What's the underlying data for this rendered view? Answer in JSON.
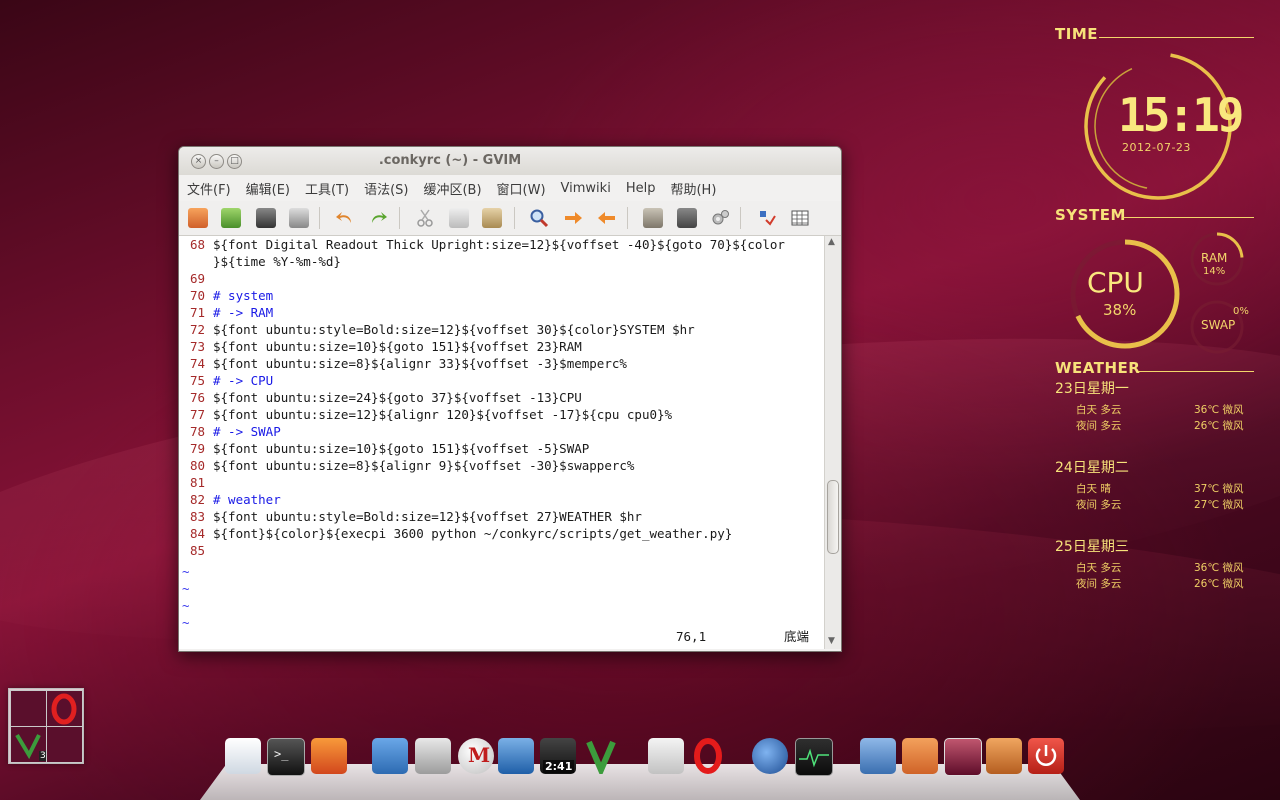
{
  "gvim": {
    "title": ".conkyrc (~) - GVIM",
    "window_buttons": {
      "close": "×",
      "minimize": "–",
      "maximize": "□"
    },
    "menu": [
      "文件(F)",
      "编辑(E)",
      "工具(T)",
      "语法(S)",
      "缓冲区(B)",
      "窗口(W)",
      "Vimwiki",
      "Help",
      "帮助(H)"
    ],
    "lines": [
      {
        "num": "68",
        "text": "${font Digital Readout Thick Upright:size=12}${voffset -40}${goto 70}${color",
        "kind": "code"
      },
      {
        "num": "",
        "text": "}${time %Y-%m-%d}",
        "kind": "code"
      },
      {
        "num": "69",
        "text": "",
        "kind": "code"
      },
      {
        "num": "70",
        "text": "# system",
        "kind": "comment"
      },
      {
        "num": "71",
        "text": "# -> RAM",
        "kind": "comment"
      },
      {
        "num": "72",
        "text": "${font ubuntu:style=Bold:size=12}${voffset 30}${color}SYSTEM $hr",
        "kind": "code"
      },
      {
        "num": "73",
        "text": "${font ubuntu:size=10}${goto 151}${voffset 23}RAM",
        "kind": "code"
      },
      {
        "num": "74",
        "text": "${font ubuntu:size=8}${alignr 33}${voffset -3}$memperc%",
        "kind": "code"
      },
      {
        "num": "75",
        "text": "# -> CPU",
        "kind": "comment"
      },
      {
        "num": "76",
        "text": "${font ubuntu:size=24}${goto 37}${voffset -13}CPU",
        "kind": "code"
      },
      {
        "num": "77",
        "text": "${font ubuntu:size=12}${alignr 120}${voffset -17}${cpu cpu0}%",
        "kind": "code"
      },
      {
        "num": "78",
        "text": "# -> SWAP",
        "kind": "comment"
      },
      {
        "num": "79",
        "text": "${font ubuntu:size=10}${goto 151}${voffset -5}SWAP",
        "kind": "code"
      },
      {
        "num": "80",
        "text": "${font ubuntu:size=8}${alignr 9}${voffset -30}$swapperc%",
        "kind": "code"
      },
      {
        "num": "81",
        "text": "",
        "kind": "code"
      },
      {
        "num": "82",
        "text": "# weather",
        "kind": "comment"
      },
      {
        "num": "83",
        "text": "${font ubuntu:style=Bold:size=12}${voffset 27}WEATHER $hr",
        "kind": "code"
      },
      {
        "num": "84",
        "text": "${font}${color}${execpi 3600 python ~/conkyrc/scripts/get_weather.py}",
        "kind": "code"
      },
      {
        "num": "85",
        "text": "",
        "kind": "code"
      }
    ],
    "tilde_lines": [
      "~",
      "~",
      "~",
      "~"
    ],
    "status": {
      "position": "76,1",
      "scroll": "底端"
    }
  },
  "conky": {
    "time_title": "TIME",
    "clock": "15:19",
    "date": "2012-07-23",
    "system_title": "SYSTEM",
    "cpu_label": "CPU",
    "cpu_pct": "38%",
    "ram_label": "RAM",
    "ram_pct": "14%",
    "swap_label": "SWAP",
    "swap_pct": "0%",
    "cpu_level": 0.38,
    "ram_level": 0.14,
    "swap_level": 0.0,
    "weather_title": "WEATHER",
    "days": [
      {
        "day": "23日星期一",
        "rows": [
          {
            "label": "白天 多云",
            "value": "36℃ 微风"
          },
          {
            "label": "夜间 多云",
            "value": "26℃ 微风"
          }
        ]
      },
      {
        "day": "24日星期二",
        "rows": [
          {
            "label": "白天 晴",
            "value": "37℃ 微风"
          },
          {
            "label": "夜间 多云",
            "value": "27℃ 微风"
          }
        ]
      },
      {
        "day": "25日星期三",
        "rows": [
          {
            "label": "白天 多云",
            "value": "36℃ 微风"
          },
          {
            "label": "夜间 多云",
            "value": "26℃ 微风"
          }
        ]
      }
    ],
    "accent": "#f3d66b"
  },
  "workspace": {
    "badge": "3"
  },
  "dock": {
    "clock_badge": "2:41"
  }
}
